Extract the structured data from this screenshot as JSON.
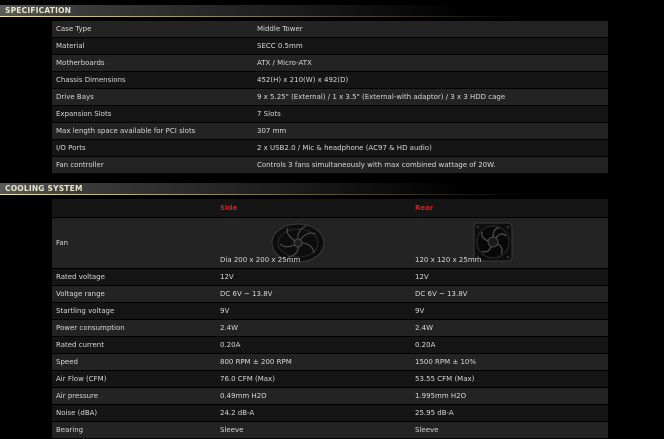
{
  "specification": {
    "title": "SPECIFICATION",
    "rows": [
      {
        "label": "Case Type",
        "value": "Middle Tower"
      },
      {
        "label": "Material",
        "value": "SECC 0.5mm"
      },
      {
        "label": "Motherboards",
        "value": "ATX / Micro-ATX"
      },
      {
        "label": "Chassis Dimensions",
        "value": "452(H) x 210(W) x 492(D)"
      },
      {
        "label": "Drive Bays",
        "value": "9 x 5.25\" (External) / 1 x 3.5\" (External-with adaptor) / 3 x 3 HDD cage"
      },
      {
        "label": "Expansion Slots",
        "value": "7 Slots"
      },
      {
        "label": "Max length space available for PCI slots",
        "value": "307 mm"
      },
      {
        "label": "I/O Ports",
        "value": "2 x USB2.0 / Mic & headphone (AC97 & HD audio)"
      },
      {
        "label": "Fan controller",
        "value": "Controls 3 fans simultaneously with max combined wattage of 20W."
      }
    ]
  },
  "cooling": {
    "title": "COOLING SYSTEM",
    "headers": {
      "side": "Side",
      "rear": "Rear"
    },
    "fan": {
      "label": "Fan",
      "side_dim": "Dia 200 x 200 x 25mm",
      "rear_dim": "120 x 120 x 25mm"
    },
    "rows": [
      {
        "label": "Rated voltage",
        "side": "12V",
        "rear": "12V"
      },
      {
        "label": "Voltage range",
        "side": "DC 6V ~ 13.8V",
        "rear": "DC 6V ~ 13.8V"
      },
      {
        "label": "Startling voltage",
        "side": "9V",
        "rear": "9V"
      },
      {
        "label": "Power consumption",
        "side": "2.4W",
        "rear": "2.4W"
      },
      {
        "label": "Rated current",
        "side": "0.20A",
        "rear": "0.20A"
      },
      {
        "label": "Speed",
        "side": "800 RPM ± 200 RPM",
        "rear": "1500 RPM ± 10%"
      },
      {
        "label": "Air Flow (CFM)",
        "side": "76.0 CFM (Max)",
        "rear": "53.55 CFM (Max)"
      },
      {
        "label": "Air pressure",
        "side": "0.49mm H2O",
        "rear": "1.995mm H2O"
      },
      {
        "label": "Noise (dBA)",
        "side": "24.2 dB-A",
        "rear": "25.95 dB-A"
      },
      {
        "label": "Bearing",
        "side": "Sleeve",
        "rear": "Sleeve"
      }
    ]
  }
}
